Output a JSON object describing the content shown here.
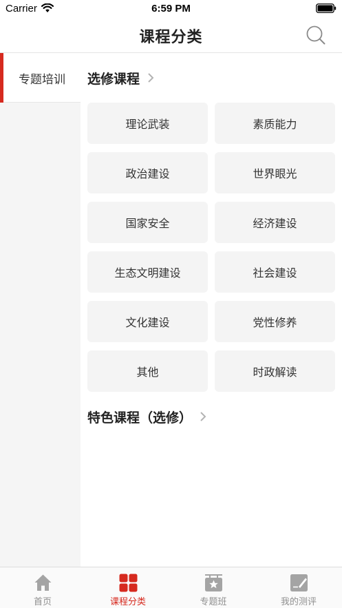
{
  "status_bar": {
    "carrier": "Carrier",
    "time": "6:59 PM",
    "wifi_icon": "wifi-icon",
    "battery_icon": "battery-icon"
  },
  "nav": {
    "title": "课程分类",
    "search_icon": "search-icon"
  },
  "sidebar": {
    "items": [
      {
        "label": "专题培训",
        "active": true
      }
    ]
  },
  "main": {
    "sections": [
      {
        "title": "选修课程",
        "courses": [
          "理论武装",
          "素质能力",
          "政治建设",
          "世界眼光",
          "国家安全",
          "经济建设",
          "生态文明建设",
          "社会建设",
          "文化建设",
          "党性修养",
          "其他",
          "时政解读"
        ]
      },
      {
        "title": "特色课程（选修）",
        "courses": []
      }
    ]
  },
  "tab_bar": {
    "items": [
      {
        "label": "首页",
        "icon": "home-icon",
        "active": false
      },
      {
        "label": "课程分类",
        "icon": "grid-icon",
        "active": true
      },
      {
        "label": "专题班",
        "icon": "star-board-icon",
        "active": false
      },
      {
        "label": "我的测评",
        "icon": "edit-note-icon",
        "active": false
      }
    ]
  },
  "colors": {
    "accent": "#d62a1f",
    "tab_inactive": "#8f8f8f",
    "tile_bg": "#f4f4f4",
    "sidebar_bg": "#f5f5f5"
  }
}
